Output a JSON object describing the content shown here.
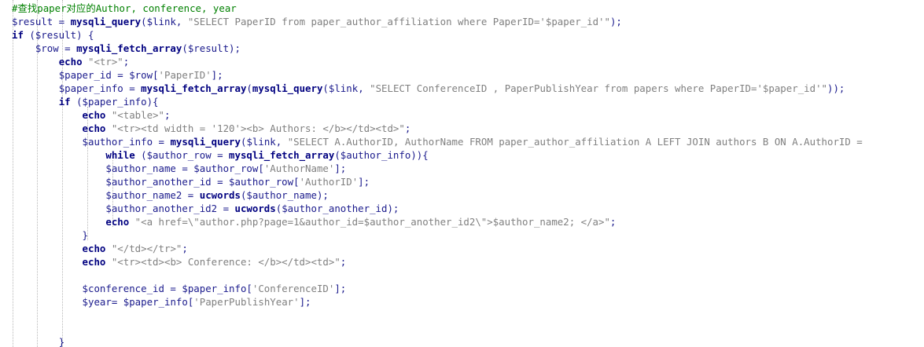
{
  "colors": {
    "background": "#ffffff",
    "comment": "#008000",
    "variable": "#1a1a8c",
    "function": "#000080",
    "keyword": "#000080",
    "string": "#808080"
  },
  "lines": [
    [
      {
        "t": "comment",
        "v": "#查找paper对应的Author, conference, year"
      }
    ],
    [
      {
        "t": "var",
        "v": "$result"
      },
      {
        "t": "punc",
        "v": " = "
      },
      {
        "t": "fn",
        "v": "mysqli_query"
      },
      {
        "t": "punc",
        "v": "("
      },
      {
        "t": "var",
        "v": "$link"
      },
      {
        "t": "punc",
        "v": ", "
      },
      {
        "t": "str",
        "v": "\"SELECT PaperID from paper_author_affiliation where PaperID='$paper_id'\""
      },
      {
        "t": "punc",
        "v": ");"
      }
    ],
    [
      {
        "t": "kw",
        "v": "if"
      },
      {
        "t": "punc",
        "v": " ("
      },
      {
        "t": "var",
        "v": "$result"
      },
      {
        "t": "punc",
        "v": ") {"
      }
    ],
    [
      {
        "t": "plain",
        "v": "    "
      },
      {
        "t": "var",
        "v": "$row"
      },
      {
        "t": "punc",
        "v": " = "
      },
      {
        "t": "fn",
        "v": "mysqli_fetch_array"
      },
      {
        "t": "punc",
        "v": "("
      },
      {
        "t": "var",
        "v": "$result"
      },
      {
        "t": "punc",
        "v": ");"
      }
    ],
    [
      {
        "t": "plain",
        "v": "        "
      },
      {
        "t": "kw",
        "v": "echo"
      },
      {
        "t": "punc",
        "v": " "
      },
      {
        "t": "str",
        "v": "\"<tr>\""
      },
      {
        "t": "punc",
        "v": ";"
      }
    ],
    [
      {
        "t": "plain",
        "v": "        "
      },
      {
        "t": "var",
        "v": "$paper_id"
      },
      {
        "t": "punc",
        "v": " = "
      },
      {
        "t": "var",
        "v": "$row"
      },
      {
        "t": "punc",
        "v": "["
      },
      {
        "t": "str",
        "v": "'PaperID'"
      },
      {
        "t": "punc",
        "v": "];"
      }
    ],
    [
      {
        "t": "plain",
        "v": "        "
      },
      {
        "t": "var",
        "v": "$paper_info"
      },
      {
        "t": "punc",
        "v": " = "
      },
      {
        "t": "fn",
        "v": "mysqli_fetch_array"
      },
      {
        "t": "punc",
        "v": "("
      },
      {
        "t": "fn",
        "v": "mysqli_query"
      },
      {
        "t": "punc",
        "v": "("
      },
      {
        "t": "var",
        "v": "$link"
      },
      {
        "t": "punc",
        "v": ", "
      },
      {
        "t": "str",
        "v": "\"SELECT ConferenceID , PaperPublishYear from papers where PaperID='$paper_id'\""
      },
      {
        "t": "punc",
        "v": "));"
      }
    ],
    [
      {
        "t": "plain",
        "v": "        "
      },
      {
        "t": "kw",
        "v": "if"
      },
      {
        "t": "punc",
        "v": " ("
      },
      {
        "t": "var",
        "v": "$paper_info"
      },
      {
        "t": "punc",
        "v": "){"
      }
    ],
    [
      {
        "t": "plain",
        "v": "            "
      },
      {
        "t": "kw",
        "v": "echo"
      },
      {
        "t": "punc",
        "v": " "
      },
      {
        "t": "str",
        "v": "\"<table>\""
      },
      {
        "t": "punc",
        "v": ";"
      }
    ],
    [
      {
        "t": "plain",
        "v": "            "
      },
      {
        "t": "kw",
        "v": "echo"
      },
      {
        "t": "punc",
        "v": " "
      },
      {
        "t": "str",
        "v": "\"<tr><td width = '120'><b> Authors: </b></td><td>\""
      },
      {
        "t": "punc",
        "v": ";"
      }
    ],
    [
      {
        "t": "plain",
        "v": "            "
      },
      {
        "t": "var",
        "v": "$author_info"
      },
      {
        "t": "punc",
        "v": " = "
      },
      {
        "t": "fn",
        "v": "mysqli_query"
      },
      {
        "t": "punc",
        "v": "("
      },
      {
        "t": "var",
        "v": "$link"
      },
      {
        "t": "punc",
        "v": ", "
      },
      {
        "t": "str",
        "v": "\"SELECT A.AuthorID, AuthorName FROM paper_author_affiliation A LEFT JOIN authors B ON A.AuthorID = "
      }
    ],
    [
      {
        "t": "plain",
        "v": "                "
      },
      {
        "t": "kw",
        "v": "while"
      },
      {
        "t": "punc",
        "v": " ("
      },
      {
        "t": "var",
        "v": "$author_row"
      },
      {
        "t": "punc",
        "v": " = "
      },
      {
        "t": "fn",
        "v": "mysqli_fetch_array"
      },
      {
        "t": "punc",
        "v": "("
      },
      {
        "t": "var",
        "v": "$author_info"
      },
      {
        "t": "punc",
        "v": ")){"
      }
    ],
    [
      {
        "t": "plain",
        "v": "                "
      },
      {
        "t": "var",
        "v": "$author_name"
      },
      {
        "t": "punc",
        "v": " = "
      },
      {
        "t": "var",
        "v": "$author_row"
      },
      {
        "t": "punc",
        "v": "["
      },
      {
        "t": "str",
        "v": "'AuthorName'"
      },
      {
        "t": "punc",
        "v": "];"
      }
    ],
    [
      {
        "t": "plain",
        "v": "                "
      },
      {
        "t": "var",
        "v": "$author_another_id"
      },
      {
        "t": "punc",
        "v": " = "
      },
      {
        "t": "var",
        "v": "$author_row"
      },
      {
        "t": "punc",
        "v": "["
      },
      {
        "t": "str",
        "v": "'AuthorID'"
      },
      {
        "t": "punc",
        "v": "];"
      }
    ],
    [
      {
        "t": "plain",
        "v": "                "
      },
      {
        "t": "var",
        "v": "$author_name2"
      },
      {
        "t": "punc",
        "v": " = "
      },
      {
        "t": "fn",
        "v": "ucwords"
      },
      {
        "t": "punc",
        "v": "("
      },
      {
        "t": "var",
        "v": "$author_name"
      },
      {
        "t": "punc",
        "v": ");"
      }
    ],
    [
      {
        "t": "plain",
        "v": "                "
      },
      {
        "t": "var",
        "v": "$author_another_id2"
      },
      {
        "t": "punc",
        "v": " = "
      },
      {
        "t": "fn",
        "v": "ucwords"
      },
      {
        "t": "punc",
        "v": "("
      },
      {
        "t": "var",
        "v": "$author_another_id"
      },
      {
        "t": "punc",
        "v": ");"
      }
    ],
    [
      {
        "t": "plain",
        "v": "                "
      },
      {
        "t": "kw",
        "v": "echo"
      },
      {
        "t": "punc",
        "v": " "
      },
      {
        "t": "str",
        "v": "\"<a href=\\\"author.php?page=1&author_id=$author_another_id2\\\">$author_name2; </a>\""
      },
      {
        "t": "punc",
        "v": ";"
      }
    ],
    [
      {
        "t": "plain",
        "v": "            "
      },
      {
        "t": "punc",
        "v": "}"
      }
    ],
    [
      {
        "t": "plain",
        "v": "            "
      },
      {
        "t": "kw",
        "v": "echo"
      },
      {
        "t": "punc",
        "v": " "
      },
      {
        "t": "str",
        "v": "\"</td></tr>\""
      },
      {
        "t": "punc",
        "v": ";"
      }
    ],
    [
      {
        "t": "plain",
        "v": "            "
      },
      {
        "t": "kw",
        "v": "echo"
      },
      {
        "t": "punc",
        "v": " "
      },
      {
        "t": "str",
        "v": "\"<tr><td><b> Conference: </b></td><td>\""
      },
      {
        "t": "punc",
        "v": ";"
      }
    ],
    [],
    [
      {
        "t": "plain",
        "v": "            "
      },
      {
        "t": "var",
        "v": "$conference_id"
      },
      {
        "t": "punc",
        "v": " = "
      },
      {
        "t": "var",
        "v": "$paper_info"
      },
      {
        "t": "punc",
        "v": "["
      },
      {
        "t": "str",
        "v": "'ConferenceID'"
      },
      {
        "t": "punc",
        "v": "];"
      }
    ],
    [
      {
        "t": "plain",
        "v": "            "
      },
      {
        "t": "var",
        "v": "$year"
      },
      {
        "t": "punc",
        "v": "= "
      },
      {
        "t": "var",
        "v": "$paper_info"
      },
      {
        "t": "punc",
        "v": "["
      },
      {
        "t": "str",
        "v": "'PaperPublishYear'"
      },
      {
        "t": "punc",
        "v": "];"
      }
    ],
    [],
    [],
    [
      {
        "t": "plain",
        "v": "        "
      },
      {
        "t": "punc",
        "v": "}"
      }
    ],
    []
  ]
}
